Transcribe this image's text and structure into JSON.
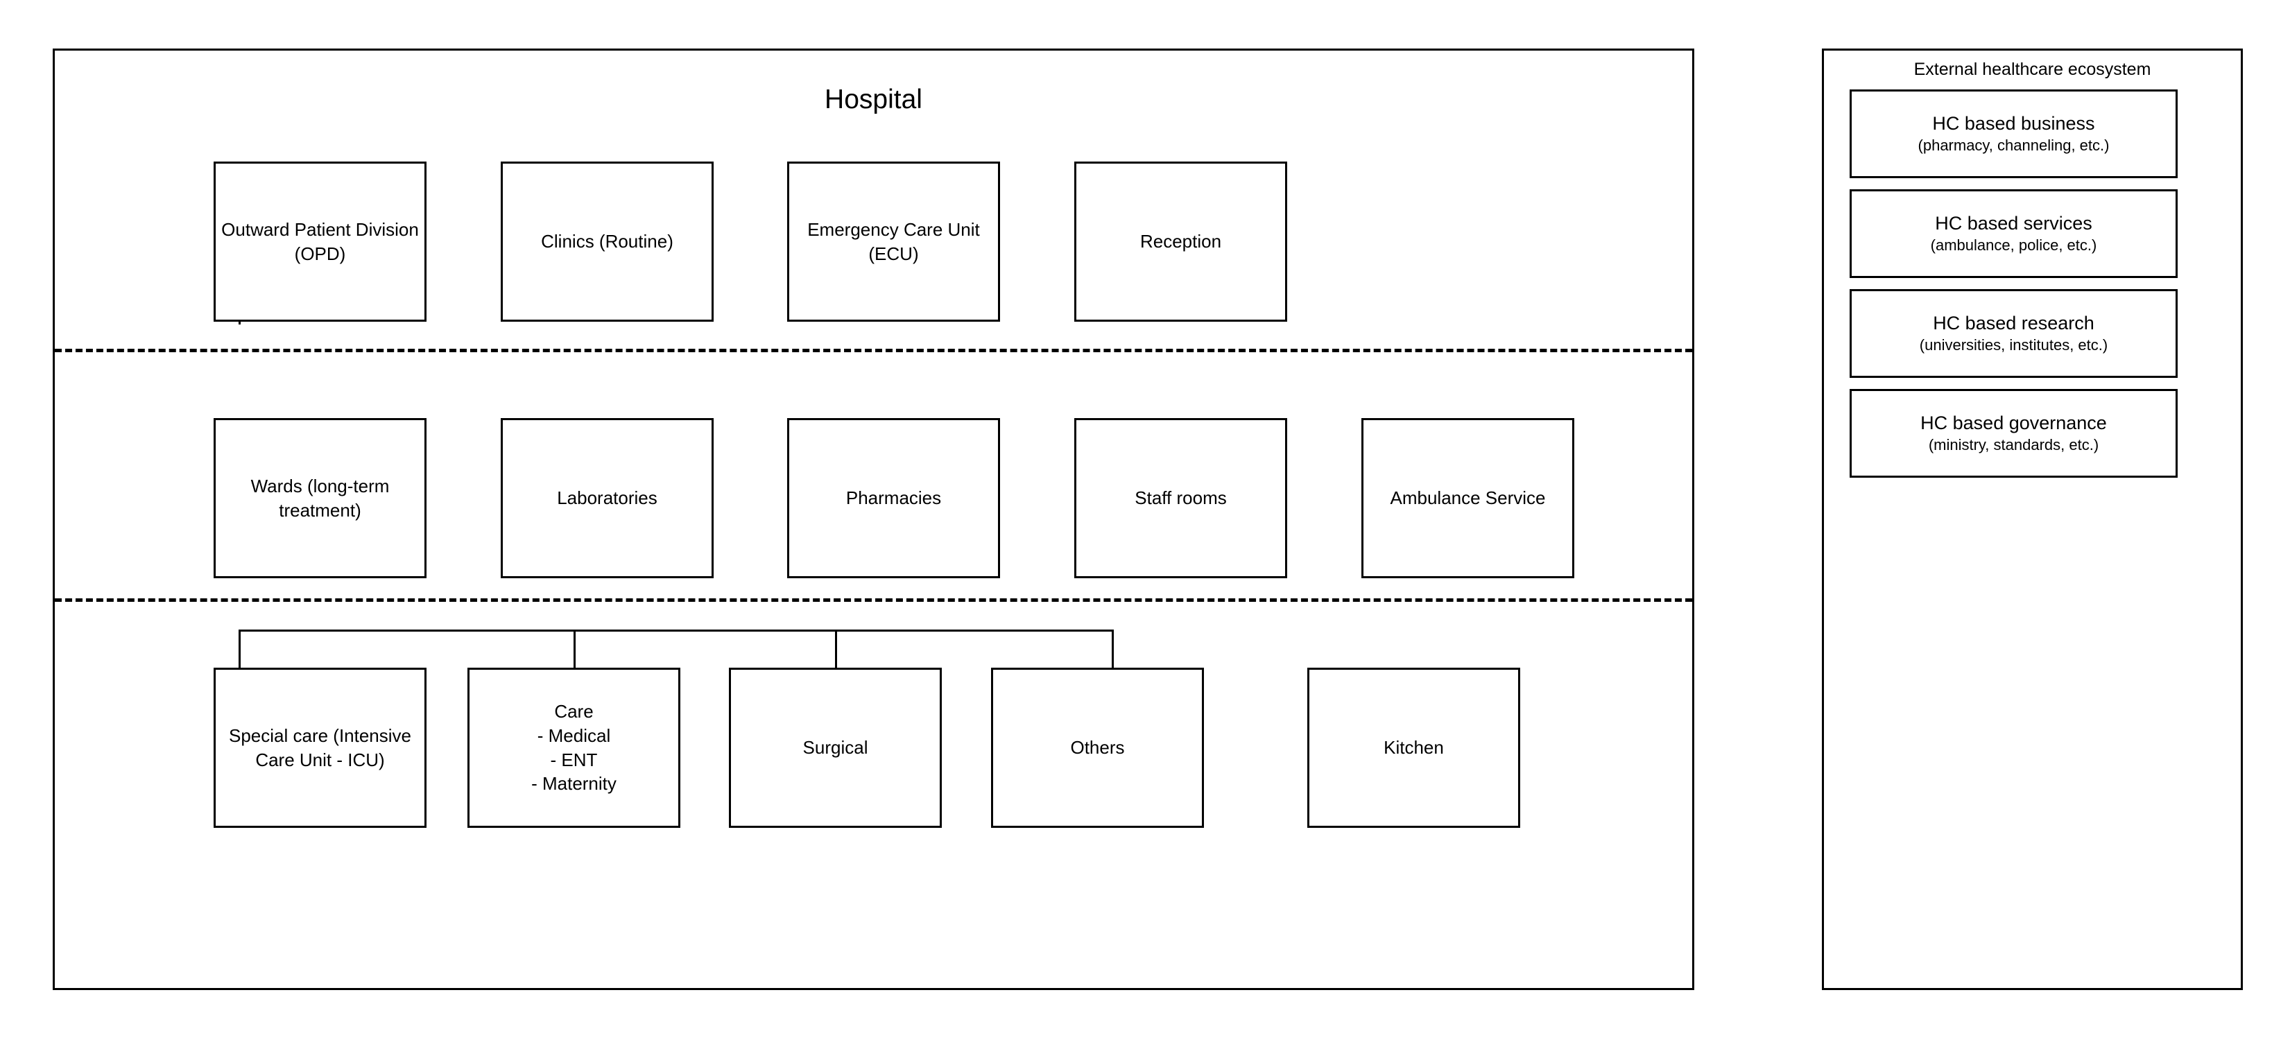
{
  "diagram": {
    "type": "block-diagram",
    "hospital": {
      "title": "Hospital",
      "tier1": [
        {
          "label": "Outward Patient Division (OPD)"
        },
        {
          "label": "Clinics (Routine)"
        },
        {
          "label": "Emergency Care Unit (ECU)"
        },
        {
          "label": "Reception"
        }
      ],
      "tier2": [
        {
          "label": "Wards (long-term treatment)"
        },
        {
          "label": "Laboratories"
        },
        {
          "label": "Pharmacies"
        },
        {
          "label": "Staff rooms"
        },
        {
          "label": "Ambulance Service"
        }
      ],
      "tier3": [
        {
          "label": "Special care (Intensive Care Unit - ICU)"
        },
        {
          "label": "Care\n- Medical\n- ENT\n- Maternity"
        },
        {
          "label": "Surgical"
        },
        {
          "label": "Others"
        },
        {
          "label": "Kitchen"
        }
      ]
    },
    "ecosystem": {
      "title": "External healthcare ecosystem",
      "items": [
        {
          "title": "HC based business",
          "subtitle": "(pharmacy, channeling, etc.)"
        },
        {
          "title": "HC based services",
          "subtitle": "(ambulance, police, etc.)"
        },
        {
          "title": "HC based research",
          "subtitle": "(universities, institutes, etc.)"
        },
        {
          "title": "HC based governance",
          "subtitle": "(ministry, standards, etc.)"
        }
      ]
    },
    "colors": {
      "stroke": "#000000",
      "background": "#ffffff",
      "text": "#000000"
    }
  }
}
